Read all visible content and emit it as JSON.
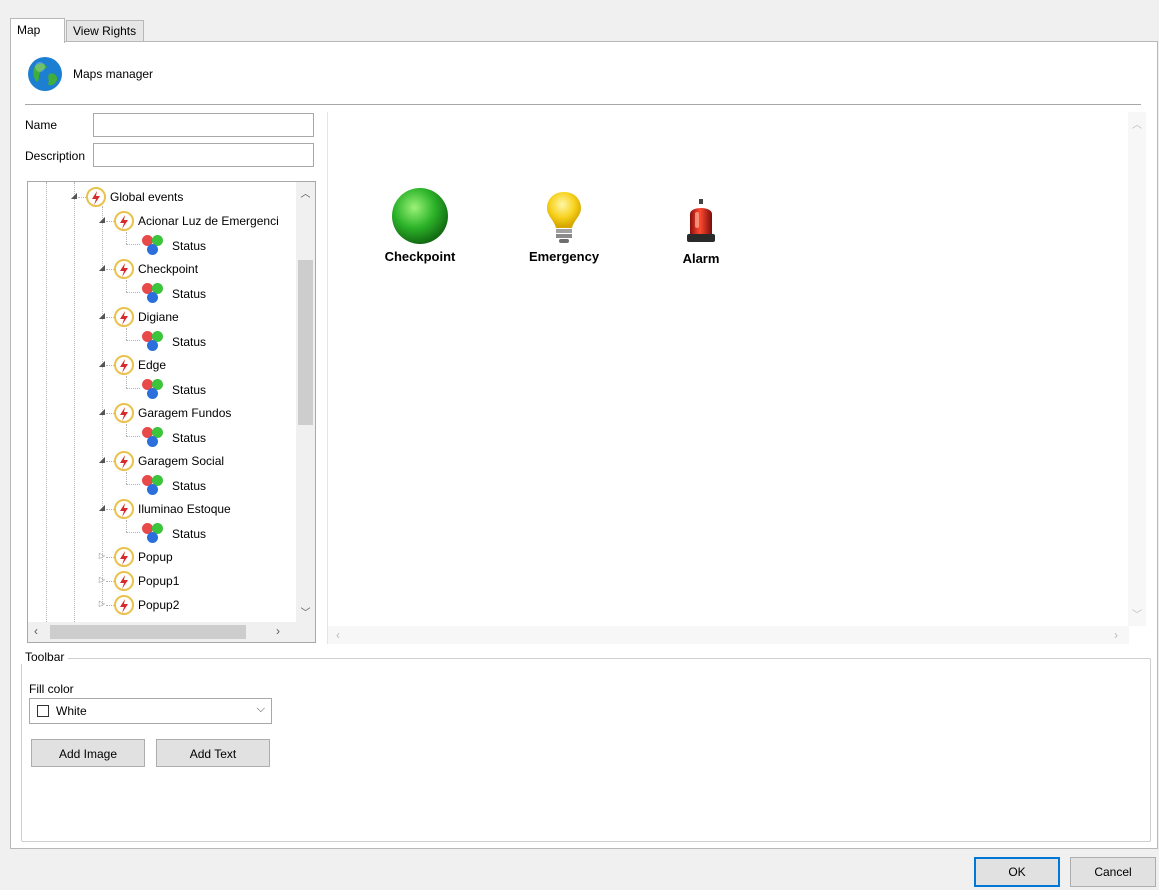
{
  "tabs": [
    {
      "label": "Map",
      "active": true
    },
    {
      "label": "View Rights",
      "active": false
    }
  ],
  "header": {
    "title": "Maps manager",
    "icon": "globe-icon"
  },
  "form": {
    "name_label": "Name",
    "name_value": "",
    "description_label": "Description",
    "description_value": ""
  },
  "tree": {
    "root": {
      "label": "Global events",
      "icon": "event-bolt-icon"
    },
    "events": [
      {
        "label": "Acionar Luz de Emergenci",
        "expanded": true,
        "child": "Status"
      },
      {
        "label": "Checkpoint",
        "expanded": true,
        "child": "Status"
      },
      {
        "label": "Digiane",
        "expanded": true,
        "child": "Status"
      },
      {
        "label": "Edge",
        "expanded": true,
        "child": "Status"
      },
      {
        "label": "Garagem Fundos",
        "expanded": true,
        "child": "Status"
      },
      {
        "label": "Garagem Social",
        "expanded": true,
        "child": "Status"
      },
      {
        "label": "Iluminao Estoque",
        "expanded": true,
        "child": "Status"
      },
      {
        "label": "Popup",
        "expanded": false
      },
      {
        "label": "Popup1",
        "expanded": false
      },
      {
        "label": "Popup2",
        "expanded": false
      }
    ]
  },
  "map_items": [
    {
      "label": "Checkpoint",
      "icon": "green-ball-icon"
    },
    {
      "label": "Emergency",
      "icon": "lightbulb-icon"
    },
    {
      "label": "Alarm",
      "icon": "siren-icon"
    }
  ],
  "toolbar": {
    "group_title": "Toolbar",
    "fill_color_label": "Fill color",
    "fill_color_value": "White",
    "add_image_label": "Add Image",
    "add_text_label": "Add Text"
  },
  "dialog": {
    "ok_label": "OK",
    "cancel_label": "Cancel"
  },
  "colors": {
    "accent": "#0078d7",
    "event_ring": "#e8c24a",
    "event_bolt": "#d62b2b"
  }
}
